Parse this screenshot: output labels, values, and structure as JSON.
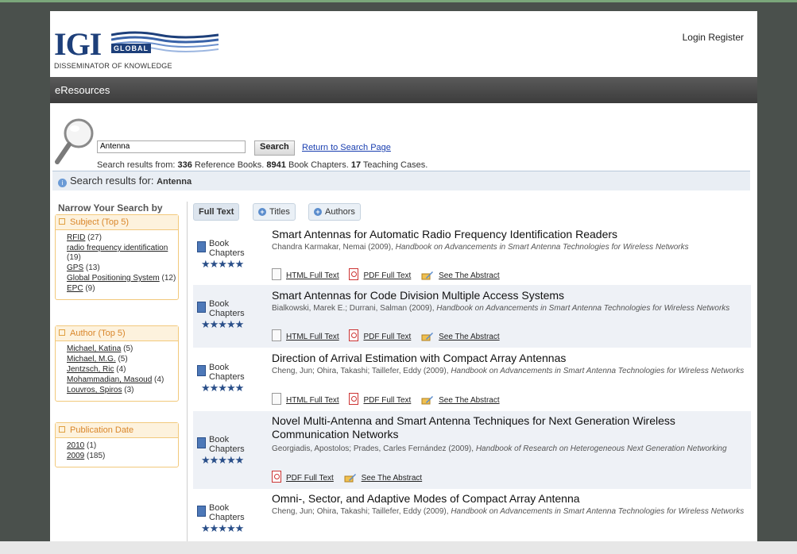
{
  "header": {
    "logo_text": "IGI",
    "logo_global": "GLOBAL",
    "logo_tagline": "DISSEMINATOR OF KNOWLEDGE",
    "login_label": "Login",
    "register_label": "Register"
  },
  "navbar": {
    "title": "eResources"
  },
  "search": {
    "value": "Antenna",
    "button_label": "Search",
    "return_link": "Return to Search Page",
    "summary_prefix": "Search results from: ",
    "ref_books_count": "336",
    "ref_books_label": " Reference Books. ",
    "chapters_count": "8941",
    "chapters_label": " Book Chapters. ",
    "cases_count": "17",
    "cases_label": " Teaching Cases."
  },
  "results_bar": {
    "label": "Search results for: ",
    "query": "Antenna"
  },
  "sidebar": {
    "title": "Narrow Your Search by",
    "subject": {
      "heading": "Subject (Top 5)",
      "items": [
        {
          "label": "RFID",
          "count": " (27)"
        },
        {
          "label": "radio frequency identification",
          "count": " (19)"
        },
        {
          "label": "GPS",
          "count": " (13)"
        },
        {
          "label": "Global Positioning System",
          "count": " (12)"
        },
        {
          "label": "EPC",
          "count": " (9)"
        }
      ]
    },
    "author": {
      "heading": "Author (Top 5)",
      "items": [
        {
          "label": "Michael, Katina",
          "count": " (5)"
        },
        {
          "label": "Michael, M.G.",
          "count": " (5)"
        },
        {
          "label": "Jentzsch, Ric",
          "count": " (4)"
        },
        {
          "label": "Mohammadian, Masoud",
          "count": " (4)"
        },
        {
          "label": "Louvros, Spiros",
          "count": " (3)"
        }
      ]
    },
    "pubdate": {
      "heading": "Publication Date",
      "items": [
        {
          "label": "2010",
          "count": " (1)"
        },
        {
          "label": "2009",
          "count": " (185)"
        }
      ]
    }
  },
  "tabs": {
    "full_text": "Full Text",
    "titles": "Titles",
    "authors": "Authors"
  },
  "results": [
    {
      "type_line1": "Book",
      "type_line2": "Chapters",
      "stars": "★★★★★",
      "title": "Smart Antennas for Automatic Radio Frequency Identification Readers",
      "authors": "Chandra Karmakar, Nemai (2009), ",
      "source": "Handbook on Advancements in Smart Antenna Technologies for Wireless Networks",
      "html_label": "HTML Full Text",
      "pdf_label": "PDF Full Text",
      "abstract_label": "See The Abstract"
    },
    {
      "type_line1": "Book",
      "type_line2": "Chapters",
      "stars": "★★★★★",
      "title": "Smart Antennas for Code Division Multiple Access Systems",
      "authors": "Bialkowski, Marek E.; Durrani, Salman (2009), ",
      "source": "Handbook on Advancements in Smart Antenna Technologies for Wireless Networks",
      "html_label": "HTML Full Text",
      "pdf_label": "PDF Full Text",
      "abstract_label": "See The Abstract"
    },
    {
      "type_line1": "Book",
      "type_line2": "Chapters",
      "stars": "★★★★★",
      "title": "Direction of Arrival Estimation with Compact Array Antennas",
      "authors": "Cheng, Jun; Ohira, Takashi; Taillefer, Eddy (2009), ",
      "source": "Handbook on Advancements in Smart Antenna Technologies for Wireless Networks",
      "html_label": "HTML Full Text",
      "pdf_label": "PDF Full Text",
      "abstract_label": "See The Abstract"
    },
    {
      "type_line1": "Book",
      "type_line2": "Chapters",
      "stars": "★★★★★",
      "title_line1": "Novel Multi-Antenna and Smart Antenna Techniques for Next Generation Wireless",
      "title_line2": "Communication Networks",
      "authors": "Georgiadis, Apostolos; Prades, Carles Fernández (2009), ",
      "source": "Handbook of Research on Heterogeneous Next Generation Networking",
      "pdf_label": "PDF Full Text",
      "abstract_label": "See The Abstract"
    },
    {
      "type_line1": "Book",
      "type_line2": "Chapters",
      "stars": "★★★★★",
      "title": "Omni-, Sector, and Adaptive Modes of Compact Array Antenna",
      "authors": "Cheng, Jun; Ohira, Takashi; Taillefer, Eddy (2009), ",
      "source": "Handbook on Advancements in Smart Antenna Technologies for Wireless Networks"
    }
  ],
  "colors": {
    "navbar": "#444444",
    "link": "#1a3fb0",
    "facet_border": "#f2c97c",
    "facet_heading": "#d9862a",
    "alt_row": "#eef1f6"
  }
}
